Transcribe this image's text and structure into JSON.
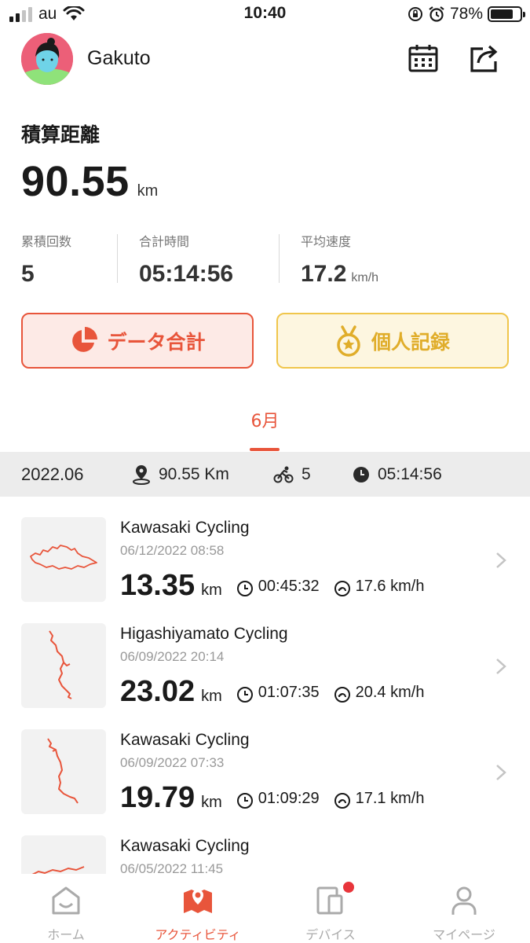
{
  "status_bar": {
    "carrier": "au",
    "time": "10:40",
    "battery_percent": "78%",
    "battery_level": 0.78
  },
  "header": {
    "username": "Gakuto"
  },
  "summary": {
    "title": "積算距離",
    "total_distance": "90.55",
    "total_unit": "km",
    "stats": [
      {
        "label": "累積回数",
        "value": "5",
        "unit": ""
      },
      {
        "label": "合計時間",
        "value": "05:14:56",
        "unit": ""
      },
      {
        "label": "平均速度",
        "value": "17.2",
        "unit": "km/h"
      }
    ]
  },
  "buttons": {
    "data_total": "データ合計",
    "personal_record": "個人記録"
  },
  "month_tab": "6月",
  "month_summary": {
    "month": "2022.06",
    "distance": "90.55 Km",
    "rides": "5",
    "time": "05:14:56"
  },
  "activities": [
    {
      "title": "Kawasaki Cycling",
      "datetime": "06/12/2022 08:58",
      "distance": "13.35",
      "unit": "km",
      "duration": "00:45:32",
      "speed": "17.6 km/h"
    },
    {
      "title": "Higashiyamato Cycling",
      "datetime": "06/09/2022 20:14",
      "distance": "23.02",
      "unit": "km",
      "duration": "01:07:35",
      "speed": "20.4 km/h"
    },
    {
      "title": "Kawasaki Cycling",
      "datetime": "06/09/2022 07:33",
      "distance": "19.79",
      "unit": "km",
      "duration": "01:09:29",
      "speed": "17.1 km/h"
    },
    {
      "title": "Kawasaki Cycling",
      "datetime": "06/05/2022 11:45"
    }
  ],
  "tabbar": {
    "items": [
      {
        "label": "ホーム",
        "icon": "home-icon"
      },
      {
        "label": "アクティビティ",
        "icon": "activity-map-icon"
      },
      {
        "label": "デバイス",
        "icon": "devices-icon"
      },
      {
        "label": "マイページ",
        "icon": "person-icon"
      }
    ],
    "active_index": 1
  },
  "colors": {
    "accent": "#e8553b",
    "gold": "#e0ad2a",
    "badge": "#e8353b"
  }
}
